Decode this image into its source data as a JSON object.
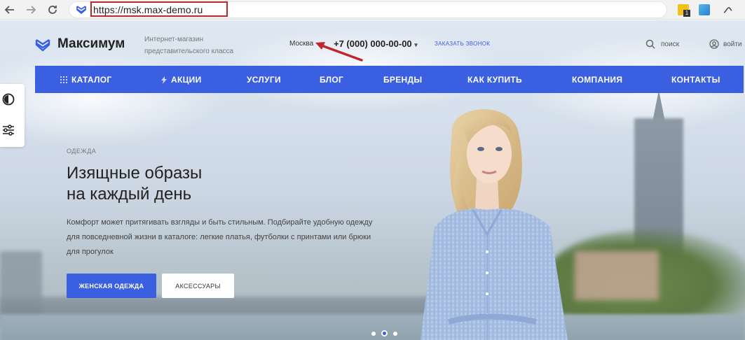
{
  "browser": {
    "url": "https://msk.max-demo.ru",
    "ext_badge": "1"
  },
  "header": {
    "logo_text": "Максимум",
    "tagline_line1": "Интернет-магазин",
    "tagline_line2": "представительского класса",
    "city": "Москва",
    "phone": "+7 (000) 000-00-00",
    "phone_caret": "▾",
    "callback": "ЗАКАЗАТЬ ЗВОНОК",
    "search": "поиск",
    "login": "войти"
  },
  "nav": {
    "catalog": "КАТАЛОГ",
    "sales": "АКЦИИ",
    "services": "УСЛУГИ",
    "blog": "БЛОГ",
    "brands": "БРЕНДЫ",
    "howtobuy": "КАК КУПИТЬ",
    "company": "КОМПАНИЯ",
    "contacts": "КОНТАКТЫ"
  },
  "hero": {
    "eyebrow": "ОДЕЖДА",
    "title_line1": "Изящные образы",
    "title_line2": "на каждый день",
    "desc_line1": "Комфорт может притягивать взгляды и быть стильным. Подбирайте удобную одежду",
    "desc_line2": "для повседневной жизни в каталоге: легкие платья, футболки с принтами или брюки",
    "desc_line3": "для прогулок",
    "btn_primary": "ЖЕНСКАЯ ОДЕЖДА",
    "btn_secondary": "АКСЕССУАРЫ"
  },
  "colors": {
    "brand": "#3a5fe0",
    "annotation": "#c0272d"
  },
  "icons": {
    "back": "arrow-left-icon",
    "forward": "arrow-right-icon",
    "reload": "reload-icon",
    "search": "search-icon",
    "login": "user-icon",
    "theme": "theme-toggle-icon",
    "filters": "sliders-icon"
  }
}
